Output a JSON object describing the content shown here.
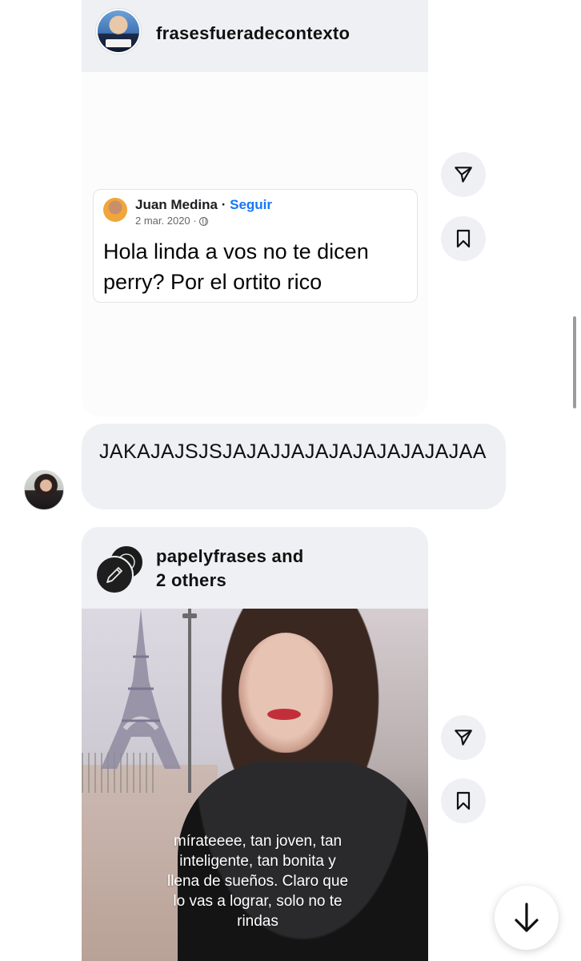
{
  "post1": {
    "username": "frasesfueradecontexto",
    "avatar_icon": "profile-avatar",
    "embed": {
      "author": "Juan Medina",
      "separator": "·",
      "follow_label": "Seguir",
      "date": "2 mar. 2020 ·",
      "audience_icon": "globe-icon",
      "text": "Hola linda a vos no te dicen perry? Por el ortito rico"
    },
    "share_icon": "send-icon",
    "save_icon": "bookmark-icon"
  },
  "message": {
    "text": "JAKAJAJSJSJAJAJJAJAJAJAJAJAJAJAA",
    "sender_avatar": "user-avatar"
  },
  "post2": {
    "username_line1": "papelyfrases and",
    "username_line2": "2 others",
    "caption_lines": [
      "mírateeee, tan joven, tan",
      "inteligente, tan bonita y",
      "llena de sueños. Claro que",
      "lo vas a lograr, solo no te",
      "rindas"
    ],
    "share_icon": "send-icon",
    "save_icon": "bookmark-icon"
  },
  "scroll_down_icon": "arrow-down-icon",
  "colors": {
    "bubble_bg": "#eef0f3",
    "link_blue": "#1877f2",
    "lip_red": "#c22f3a"
  }
}
